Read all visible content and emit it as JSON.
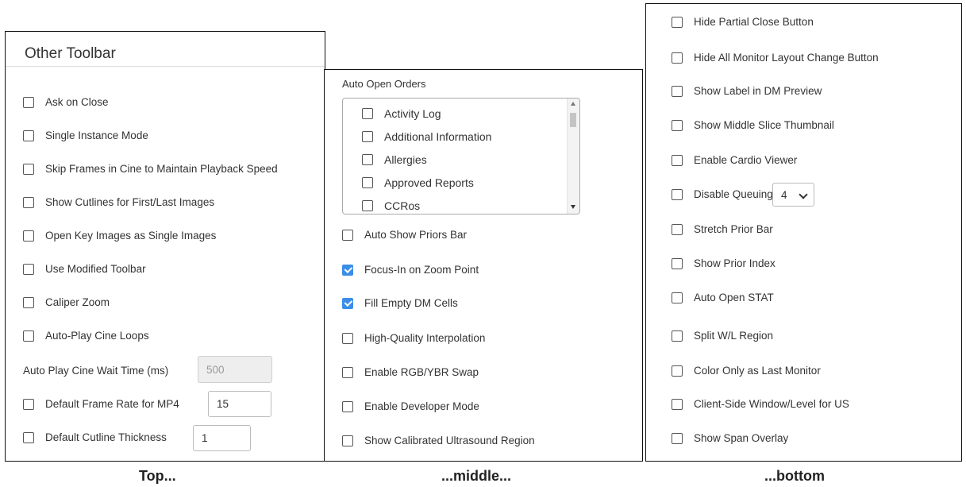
{
  "top_panel": {
    "title": "Other Toolbar",
    "checkboxes": [
      {
        "label": "Ask on Close",
        "checked": false
      },
      {
        "label": "Single Instance Mode",
        "checked": false
      },
      {
        "label": "Skip Frames in Cine to Maintain Playback Speed",
        "checked": false
      },
      {
        "label": "Show Cutlines for First/Last Images",
        "checked": false
      },
      {
        "label": "Open Key Images as Single Images",
        "checked": false
      },
      {
        "label": "Use Modified Toolbar",
        "checked": false
      },
      {
        "label": "Caliper Zoom",
        "checked": false
      },
      {
        "label": "Auto-Play Cine Loops",
        "checked": false
      }
    ],
    "wait_time": {
      "label": "Auto Play Cine Wait Time (ms)",
      "value": "500",
      "disabled": true
    },
    "frame_rate": {
      "label": "Default Frame Rate for MP4",
      "value": "15",
      "checked": false
    },
    "cutline": {
      "label": "Default Cutline Thickness",
      "value": "1",
      "checked": false
    }
  },
  "middle_panel": {
    "orders_label": "Auto Open Orders",
    "orders": [
      {
        "label": "Activity Log",
        "checked": false
      },
      {
        "label": "Additional Information",
        "checked": false
      },
      {
        "label": "Allergies",
        "checked": false
      },
      {
        "label": "Approved Reports",
        "checked": false
      },
      {
        "label": "CCRos",
        "checked": false
      }
    ],
    "checkboxes": [
      {
        "label": "Auto Show Priors Bar",
        "checked": false
      },
      {
        "label": "Focus-In on Zoom Point",
        "checked": true
      },
      {
        "label": "Fill Empty DM Cells",
        "checked": true
      },
      {
        "label": "High-Quality Interpolation",
        "checked": false
      },
      {
        "label": "Enable RGB/YBR Swap",
        "checked": false
      },
      {
        "label": "Enable Developer Mode",
        "checked": false
      },
      {
        "label": "Show Calibrated Ultrasound Region",
        "checked": false
      }
    ]
  },
  "bottom_panel": {
    "checkboxes": [
      {
        "label": "Hide Partial Close Button",
        "checked": false
      },
      {
        "label": "Hide All Monitor Layout Change Button",
        "checked": false
      },
      {
        "label": "Show Label in DM Preview",
        "checked": false
      },
      {
        "label": "Show Middle Slice Thumbnail",
        "checked": false
      },
      {
        "label": "Enable Cardio Viewer",
        "checked": false
      },
      {
        "label": "Disable Queuing",
        "checked": false,
        "select_value": "4"
      },
      {
        "label": "Stretch Prior Bar",
        "checked": false
      },
      {
        "label": "Show Prior Index",
        "checked": false
      },
      {
        "label": "Auto Open STAT",
        "checked": false
      },
      {
        "label": "Split W/L Region",
        "checked": false
      },
      {
        "label": "Color Only as Last Monitor",
        "checked": false
      },
      {
        "label": "Client-Side Window/Level for US",
        "checked": false
      },
      {
        "label": "Show Span Overlay",
        "checked": false
      }
    ]
  },
  "captions": {
    "top": "Top...",
    "middle": "...middle...",
    "bottom": "...bottom"
  },
  "colors": {
    "checked": "#3b8ee8",
    "border": "#111111"
  }
}
